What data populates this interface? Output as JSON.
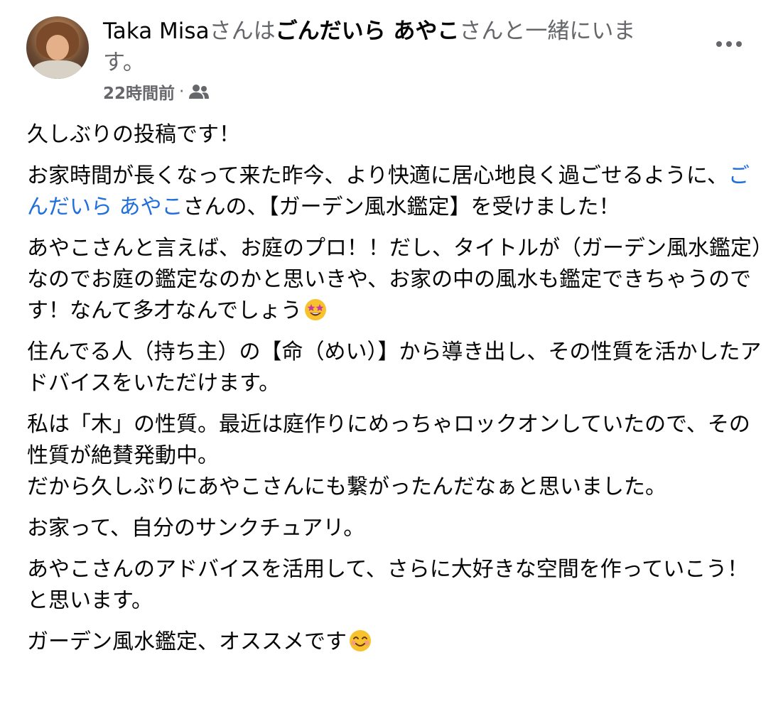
{
  "post": {
    "author": "Taka Misa",
    "with_prefix": "さんは",
    "with_name": "ごんだいら あやこ",
    "with_suffix": "さんと一緒にいます。",
    "time": "22時間前",
    "separator": "·",
    "audience_icon": "friends-icon",
    "more_icon": "more-options-icon"
  },
  "body": {
    "p1": "久しぶりの投稿です！",
    "p2_a": "お家時間が長くなって来た昨今、より快適に居心地良く過ごせるように、",
    "p2_mention": "ごんだいら あやこ",
    "p2_b": "さんの、【ガーデン風水鑑定】を受けました！",
    "p3": "あやこさんと言えば、お庭のプロ！！だし、タイトルが（ガーデン風水鑑定）なのでお庭の鑑定なのかと思いきや、お家の中の風水も鑑定できちゃうのです！なんて多才なんでしょう",
    "p3_emoji": "star-struck-emoji",
    "p4": "住んでる人（持ち主）の【命（めい）】から導き出し、その性質を活かしたアドバイスをいただけます。",
    "p5_a": "私は「木」の性質。最近は庭作りにめっちゃロックオンしていたので、その性質が絶賛発動中。",
    "p5_b": "だから久しぶりにあやこさんにも繋がったんだなぁと思いました。",
    "p6": "お家って、自分のサンクチュアリ。",
    "p7": "あやこさんのアドバイスを活用して、さらに大好きな空間を作っていこう！と思います。",
    "p8": "ガーデン風水鑑定、オススメです",
    "p8_emoji": "smiling-face-emoji"
  },
  "colors": {
    "text": "#050505",
    "secondary": "#65676b",
    "link": "#216fdb"
  }
}
